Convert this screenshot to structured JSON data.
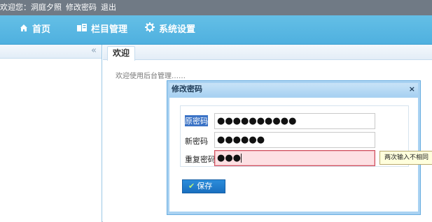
{
  "topbar": {
    "welcome": "欢迎您：洞庭夕照",
    "change_password": "修改密码",
    "logout": "退出"
  },
  "nav": {
    "items": [
      {
        "label": "首页",
        "icon": "home-icon"
      },
      {
        "label": "栏目管理",
        "icon": "column-manage-icon"
      },
      {
        "label": "系统设置",
        "icon": "gear-icon"
      }
    ]
  },
  "sidebar": {
    "collapse_glyph": "«"
  },
  "content": {
    "tab_label": "欢迎",
    "welcome_text": "欢迎使用后台管理……"
  },
  "dialog": {
    "title": "修改密码",
    "close_glyph": "×",
    "fields": [
      {
        "label": "原密码",
        "value": "●●●●●●●●●●"
      },
      {
        "label": "新密码",
        "value": "●●●●●●"
      },
      {
        "label": "重复密码",
        "value": "●●●"
      }
    ],
    "error_tooltip": "两次输入不相同",
    "save_label": "保存"
  },
  "colors": {
    "nav_bg": "#55b4e1",
    "topbar_bg": "#707a85",
    "error_bg": "#fde0e3",
    "save_btn": "#1f7ccc"
  }
}
